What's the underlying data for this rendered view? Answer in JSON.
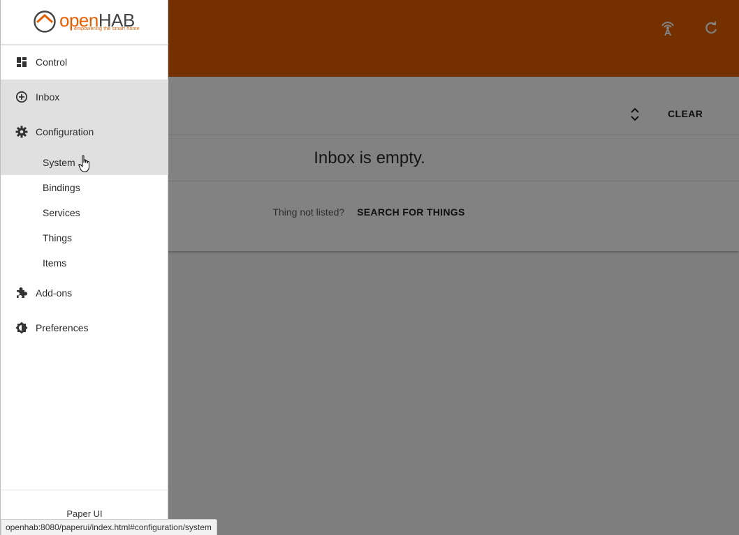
{
  "header": {
    "icons": [
      "wifi-tower-icon",
      "refresh-icon"
    ],
    "bg_color": "#e65e00"
  },
  "inbox": {
    "clear_label": "CLEAR",
    "empty_message": "Inbox is empty.",
    "hint": "Thing not listed?",
    "search_label": "SEARCH FOR THINGS"
  },
  "logo": {
    "brand_open": "open",
    "brand_hab": "HAB",
    "tagline": "empowering the smart home"
  },
  "sidebar": {
    "items": [
      {
        "label": "Control",
        "icon": "dashboard-icon"
      },
      {
        "label": "Inbox",
        "icon": "add-circle-icon"
      },
      {
        "label": "Configuration",
        "icon": "gear-icon"
      },
      {
        "label": "Add-ons",
        "icon": "puzzle-icon"
      },
      {
        "label": "Preferences",
        "icon": "brightness-icon"
      }
    ],
    "config_sub": [
      {
        "label": "System"
      },
      {
        "label": "Bindings"
      },
      {
        "label": "Services"
      },
      {
        "label": "Things"
      },
      {
        "label": "Items"
      }
    ],
    "footer": "Paper UI"
  },
  "status_url": "openhab:8080/paperui/index.html#configuration/system",
  "colors": {
    "accent": "#e65e00",
    "highlight": "#e0e0e0"
  }
}
